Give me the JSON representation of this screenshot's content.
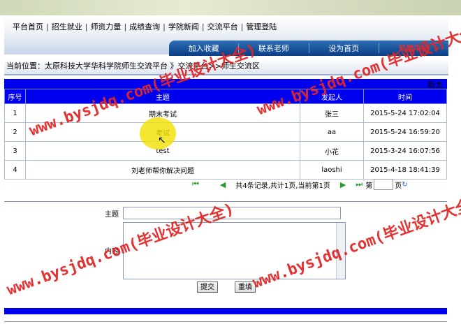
{
  "top_nav": {
    "items": [
      "平台首页",
      "招生就业",
      "师资力量",
      "成绩查询",
      "学院新闻",
      "交流平台",
      "管理登陆"
    ]
  },
  "blue_nav": {
    "items": [
      "加入收藏",
      "联系老师",
      "设为首页",
      "繁體中文"
    ]
  },
  "breadcrumb": {
    "text": "当前位置：太原科技大学华科学院师生交流平台 》交流平台>>师生交流区"
  },
  "list_header": {
    "right_text": "新主"
  },
  "table": {
    "columns": [
      "序号",
      "主题",
      "发起人",
      "时间"
    ],
    "rows": [
      [
        "1",
        "期末考试",
        "张三",
        "2015-5-24 17:02:04"
      ],
      [
        "2",
        "考试",
        "aa",
        "2015-5-24 16:59:20"
      ],
      [
        "3",
        "test",
        "小花",
        "2015-3-24 16:07:56"
      ],
      [
        "4",
        "刘老师帮你解决问题",
        "laoshi",
        "2015-4-18 18:41:39"
      ]
    ]
  },
  "pager": {
    "info": "共4条记录,共计1页,当前第1页",
    "goto_prefix": "第",
    "goto_suffix": "页"
  },
  "form": {
    "subject_label": "主题",
    "content_label": "内容",
    "submit_label": "提交",
    "reset_label": "重填"
  },
  "watermark": {
    "text": "www.bysjdq.com(毕业设计大全)",
    "color": "#e32626"
  },
  "colors": {
    "header_blue": "#0000ee",
    "nav_blue": "#0b3f86"
  }
}
